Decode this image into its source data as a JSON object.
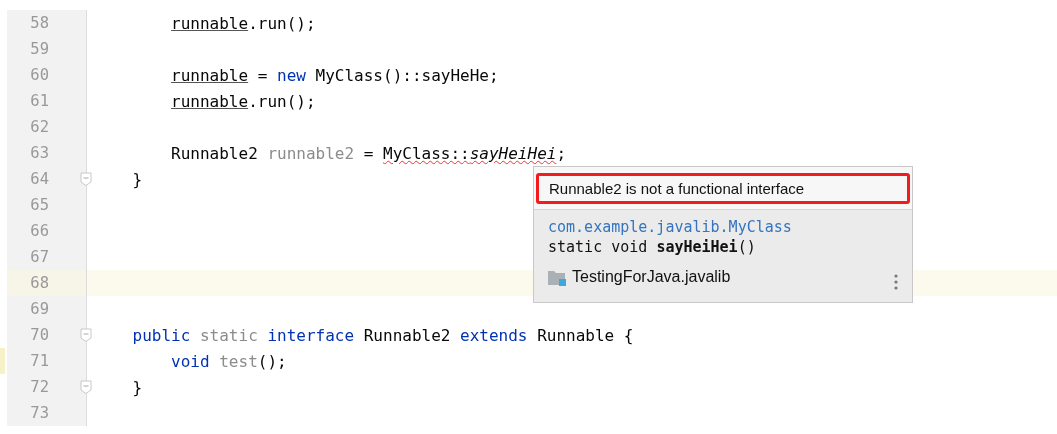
{
  "editor": {
    "lines": [
      {
        "number": "58",
        "kind": "statement",
        "tokens": [
          {
            "text": "runnable",
            "kind": "underline"
          },
          {
            "text": ".run();",
            "kind": "plain"
          }
        ],
        "fold": false,
        "current": false,
        "changed": false
      },
      {
        "number": "59",
        "fold": false,
        "current": false,
        "changed": false
      },
      {
        "number": "60",
        "kind": "statement",
        "tokens": [
          {
            "text": "runnable",
            "kind": "underline"
          },
          {
            "text": " = ",
            "kind": "plain"
          },
          {
            "text": "new",
            "kind": "keyword"
          },
          {
            "text": " MyClass()::sayHeHe;",
            "kind": "plain"
          }
        ],
        "fold": false,
        "current": false,
        "changed": false
      },
      {
        "number": "61",
        "kind": "statement",
        "tokens": [
          {
            "text": "runnable",
            "kind": "underline"
          },
          {
            "text": ".run();",
            "kind": "plain"
          }
        ],
        "fold": false,
        "current": false,
        "changed": false
      },
      {
        "number": "62",
        "fold": false,
        "current": false,
        "changed": false
      },
      {
        "number": "63",
        "kind": "statement",
        "tokens": [
          {
            "text": "Runnable2 ",
            "kind": "plain"
          },
          {
            "text": "runnable2",
            "kind": "dim"
          },
          {
            "text": " = ",
            "kind": "plain"
          },
          {
            "text": "MyClass::",
            "kind": "error"
          },
          {
            "text": "sayHeiHei",
            "kind": "error-italic"
          },
          {
            "text": ";",
            "kind": "plain"
          }
        ],
        "fold": false,
        "current": false,
        "changed": false
      },
      {
        "number": "64",
        "kind": "member",
        "tokens": [
          {
            "text": "}",
            "kind": "plain"
          }
        ],
        "fold": true,
        "current": false,
        "changed": false
      },
      {
        "number": "65",
        "fold": false,
        "current": false,
        "changed": false
      },
      {
        "number": "66",
        "fold": false,
        "current": false,
        "changed": false
      },
      {
        "number": "67",
        "fold": false,
        "current": false,
        "changed": false
      },
      {
        "number": "68",
        "fold": false,
        "current": true,
        "changed": false
      },
      {
        "number": "69",
        "fold": false,
        "current": false,
        "changed": false
      },
      {
        "number": "70",
        "kind": "member",
        "tokens": [
          {
            "text": "public",
            "kind": "keyword"
          },
          {
            "text": " static",
            "kind": "dim"
          },
          {
            "text": " interface",
            "kind": "keyword"
          },
          {
            "text": " Runnable2 ",
            "kind": "plain"
          },
          {
            "text": "extends",
            "kind": "keyword"
          },
          {
            "text": " Runnable {",
            "kind": "plain"
          }
        ],
        "fold": true,
        "current": false,
        "changed": false
      },
      {
        "number": "71",
        "kind": "statement",
        "tokens": [
          {
            "text": "void",
            "kind": "keyword"
          },
          {
            "text": " test",
            "kind": "dim"
          },
          {
            "text": "();",
            "kind": "plain"
          }
        ],
        "fold": false,
        "current": false,
        "changed": true
      },
      {
        "number": "72",
        "kind": "member",
        "tokens": [
          {
            "text": "}",
            "kind": "plain"
          }
        ],
        "fold": true,
        "current": false,
        "changed": false
      },
      {
        "number": "73",
        "fold": false,
        "current": false,
        "changed": false
      }
    ]
  },
  "popup": {
    "error": "Runnable2 is not a functional interface",
    "class_path": "com.example.javalib.MyClass",
    "signature_prefix": "static void ",
    "signature_name": "sayHeiHei",
    "signature_suffix": "()",
    "module": "TestingForJava.javalib"
  }
}
